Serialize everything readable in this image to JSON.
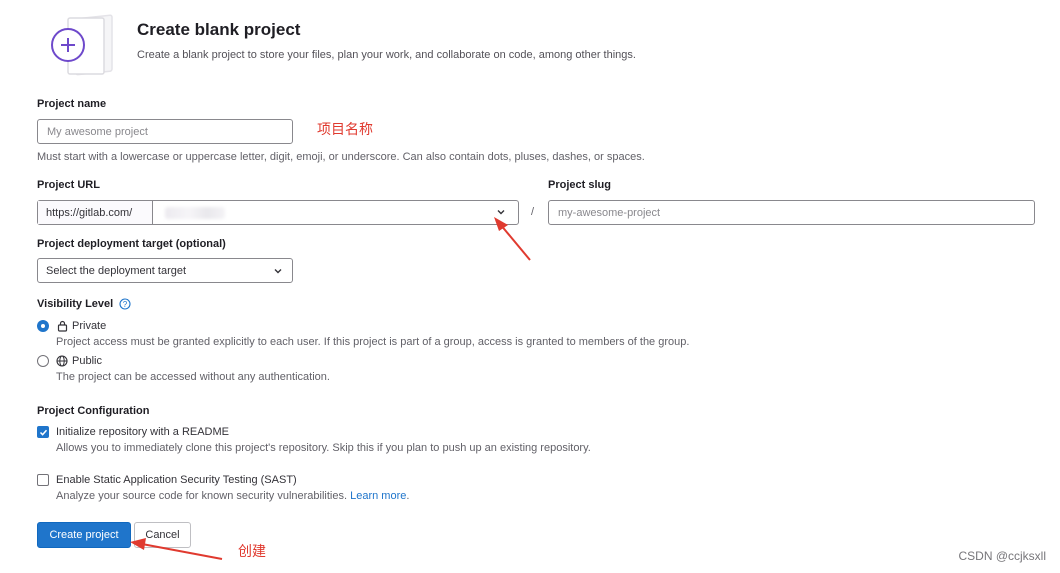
{
  "header": {
    "title": "Create blank project",
    "description": "Create a blank project to store your files, plan your work, and collaborate on code, among other things."
  },
  "project_name": {
    "label": "Project name",
    "placeholder": "My awesome project",
    "help": "Must start with a lowercase or uppercase letter, digit, emoji, or underscore. Can also contain dots, pluses, dashes, or spaces."
  },
  "project_url": {
    "label": "Project URL",
    "prefix": "https://gitlab.com/",
    "separator": "/"
  },
  "project_slug": {
    "label": "Project slug",
    "placeholder": "my-awesome-project"
  },
  "deployment": {
    "label": "Project deployment target (optional)",
    "selected": "Select the deployment target"
  },
  "visibility": {
    "label": "Visibility Level",
    "options": [
      {
        "label": "Private",
        "help": "Project access must be granted explicitly to each user. If this project is part of a group, access is granted to members of the group.",
        "checked": true,
        "icon": "lock-icon"
      },
      {
        "label": "Public",
        "help": "The project can be accessed without any authentication.",
        "checked": false,
        "icon": "globe-icon"
      }
    ]
  },
  "config": {
    "label": "Project Configuration",
    "options": [
      {
        "label": "Initialize repository with a README",
        "help": "Allows you to immediately clone this project's repository. Skip this if you plan to push up an existing repository.",
        "checked": true
      },
      {
        "label": "Enable Static Application Security Testing (SAST)",
        "help": "Analyze your source code for known security vulnerabilities.",
        "link": "Learn more",
        "checked": false
      }
    ]
  },
  "actions": {
    "create": "Create project",
    "cancel": "Cancel"
  },
  "annotations": {
    "name_note": "项目名称",
    "create_note": "创建",
    "color": "#e03a2f"
  },
  "watermark": "CSDN @ccjksxll",
  "colors": {
    "primary": "#1f75cb",
    "illustration": "#6e49cb"
  }
}
